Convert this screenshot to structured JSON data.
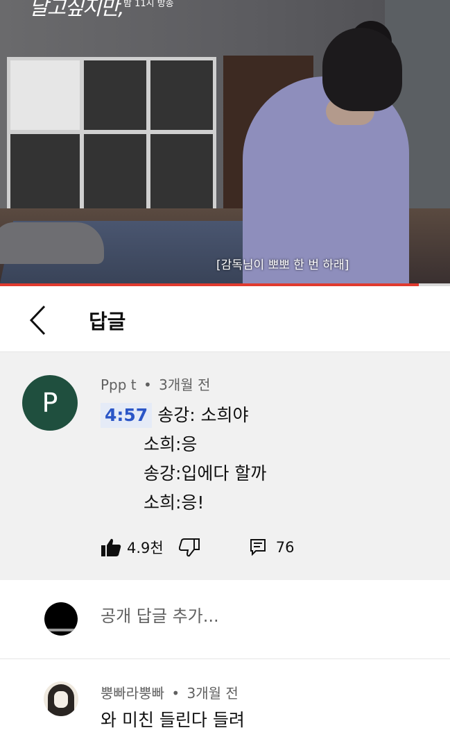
{
  "video": {
    "title_fragment": "달고싶지만,",
    "airtime": "밤 11시 방송",
    "subtitle": "[감독님이 뽀뽀 한 번 하래]",
    "progress_fraction": 0.93
  },
  "header": {
    "title": "답글",
    "back_icon": "chevron-left-icon"
  },
  "comment": {
    "avatar_letter": "P",
    "avatar_color": "#1f4f3e",
    "author": "Ppp t",
    "separator": "•",
    "time": "3개월 전",
    "timestamp": "4:57",
    "lines": [
      "송강: 소희야",
      "소희:응",
      "송강:입에다 할까",
      "소희:응!"
    ],
    "likes": "4.9천",
    "replies": "76",
    "like_icon": "thumbs-up-icon",
    "dislike_icon": "thumbs-down-icon",
    "reply_icon": "reply-icon"
  },
  "add_reply": {
    "placeholder": "공개 답글 추가..."
  },
  "reply": {
    "author": "뿡빠라뿡빠",
    "separator": "•",
    "time": "3개월 전",
    "text": "와 미친 들린다 들려"
  },
  "colors": {
    "accent_red": "#e03a2e",
    "timestamp_blue": "#2b56c7",
    "highlight_bg": "#f1f1f1"
  }
}
